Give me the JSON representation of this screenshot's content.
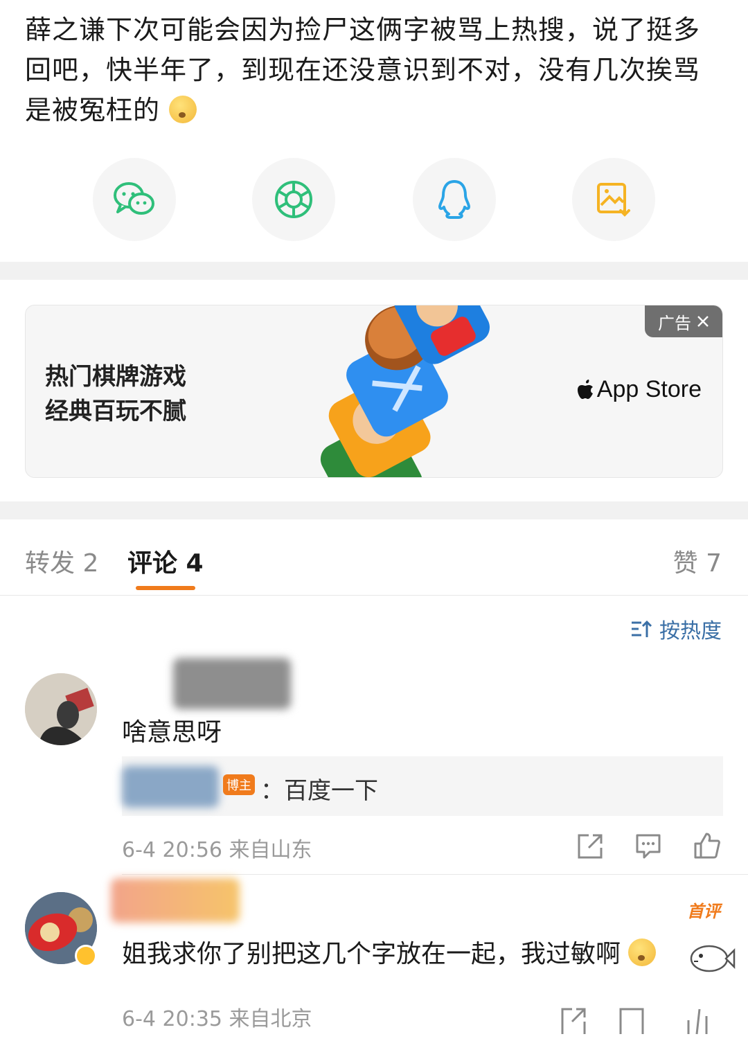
{
  "post": {
    "text": "薛之谦下次可能会因为捡尸这俩字被骂上热搜，说了挺多回吧，快半年了，到现在还没意识到不对，没有几次挨骂是被冤枉的"
  },
  "share": [
    {
      "name": "wechat",
      "icon": "wechat-icon",
      "color": "#2fbf7a"
    },
    {
      "name": "moments",
      "icon": "moments-icon",
      "color": "#2fbf7a"
    },
    {
      "name": "qq",
      "icon": "qq-icon",
      "color": "#2aa4e6"
    },
    {
      "name": "save-image",
      "icon": "save-image-icon",
      "color": "#f5b323"
    }
  ],
  "ad": {
    "tag": "广告",
    "line1": "热门棋牌游戏",
    "line2": "经典百玩不腻",
    "store": "App Store"
  },
  "tabs": {
    "repost": "转发 2",
    "comments": "评论 4",
    "likes": "赞 7"
  },
  "sort": {
    "label": "按热度"
  },
  "comments": [
    {
      "text": "啥意思呀",
      "reply_badge": "博主",
      "reply_text": "：百度一下",
      "meta": "6-4 20:56 来自山东"
    },
    {
      "badge": "首评",
      "text": "姐我求你了别把这几个字放在一起，我过敏啊",
      "meta": "6-4 20:35 来自北京"
    }
  ],
  "colors": {
    "accent": "#f07b1c",
    "link": "#3a6fa6",
    "muted": "#9a9a9a"
  }
}
